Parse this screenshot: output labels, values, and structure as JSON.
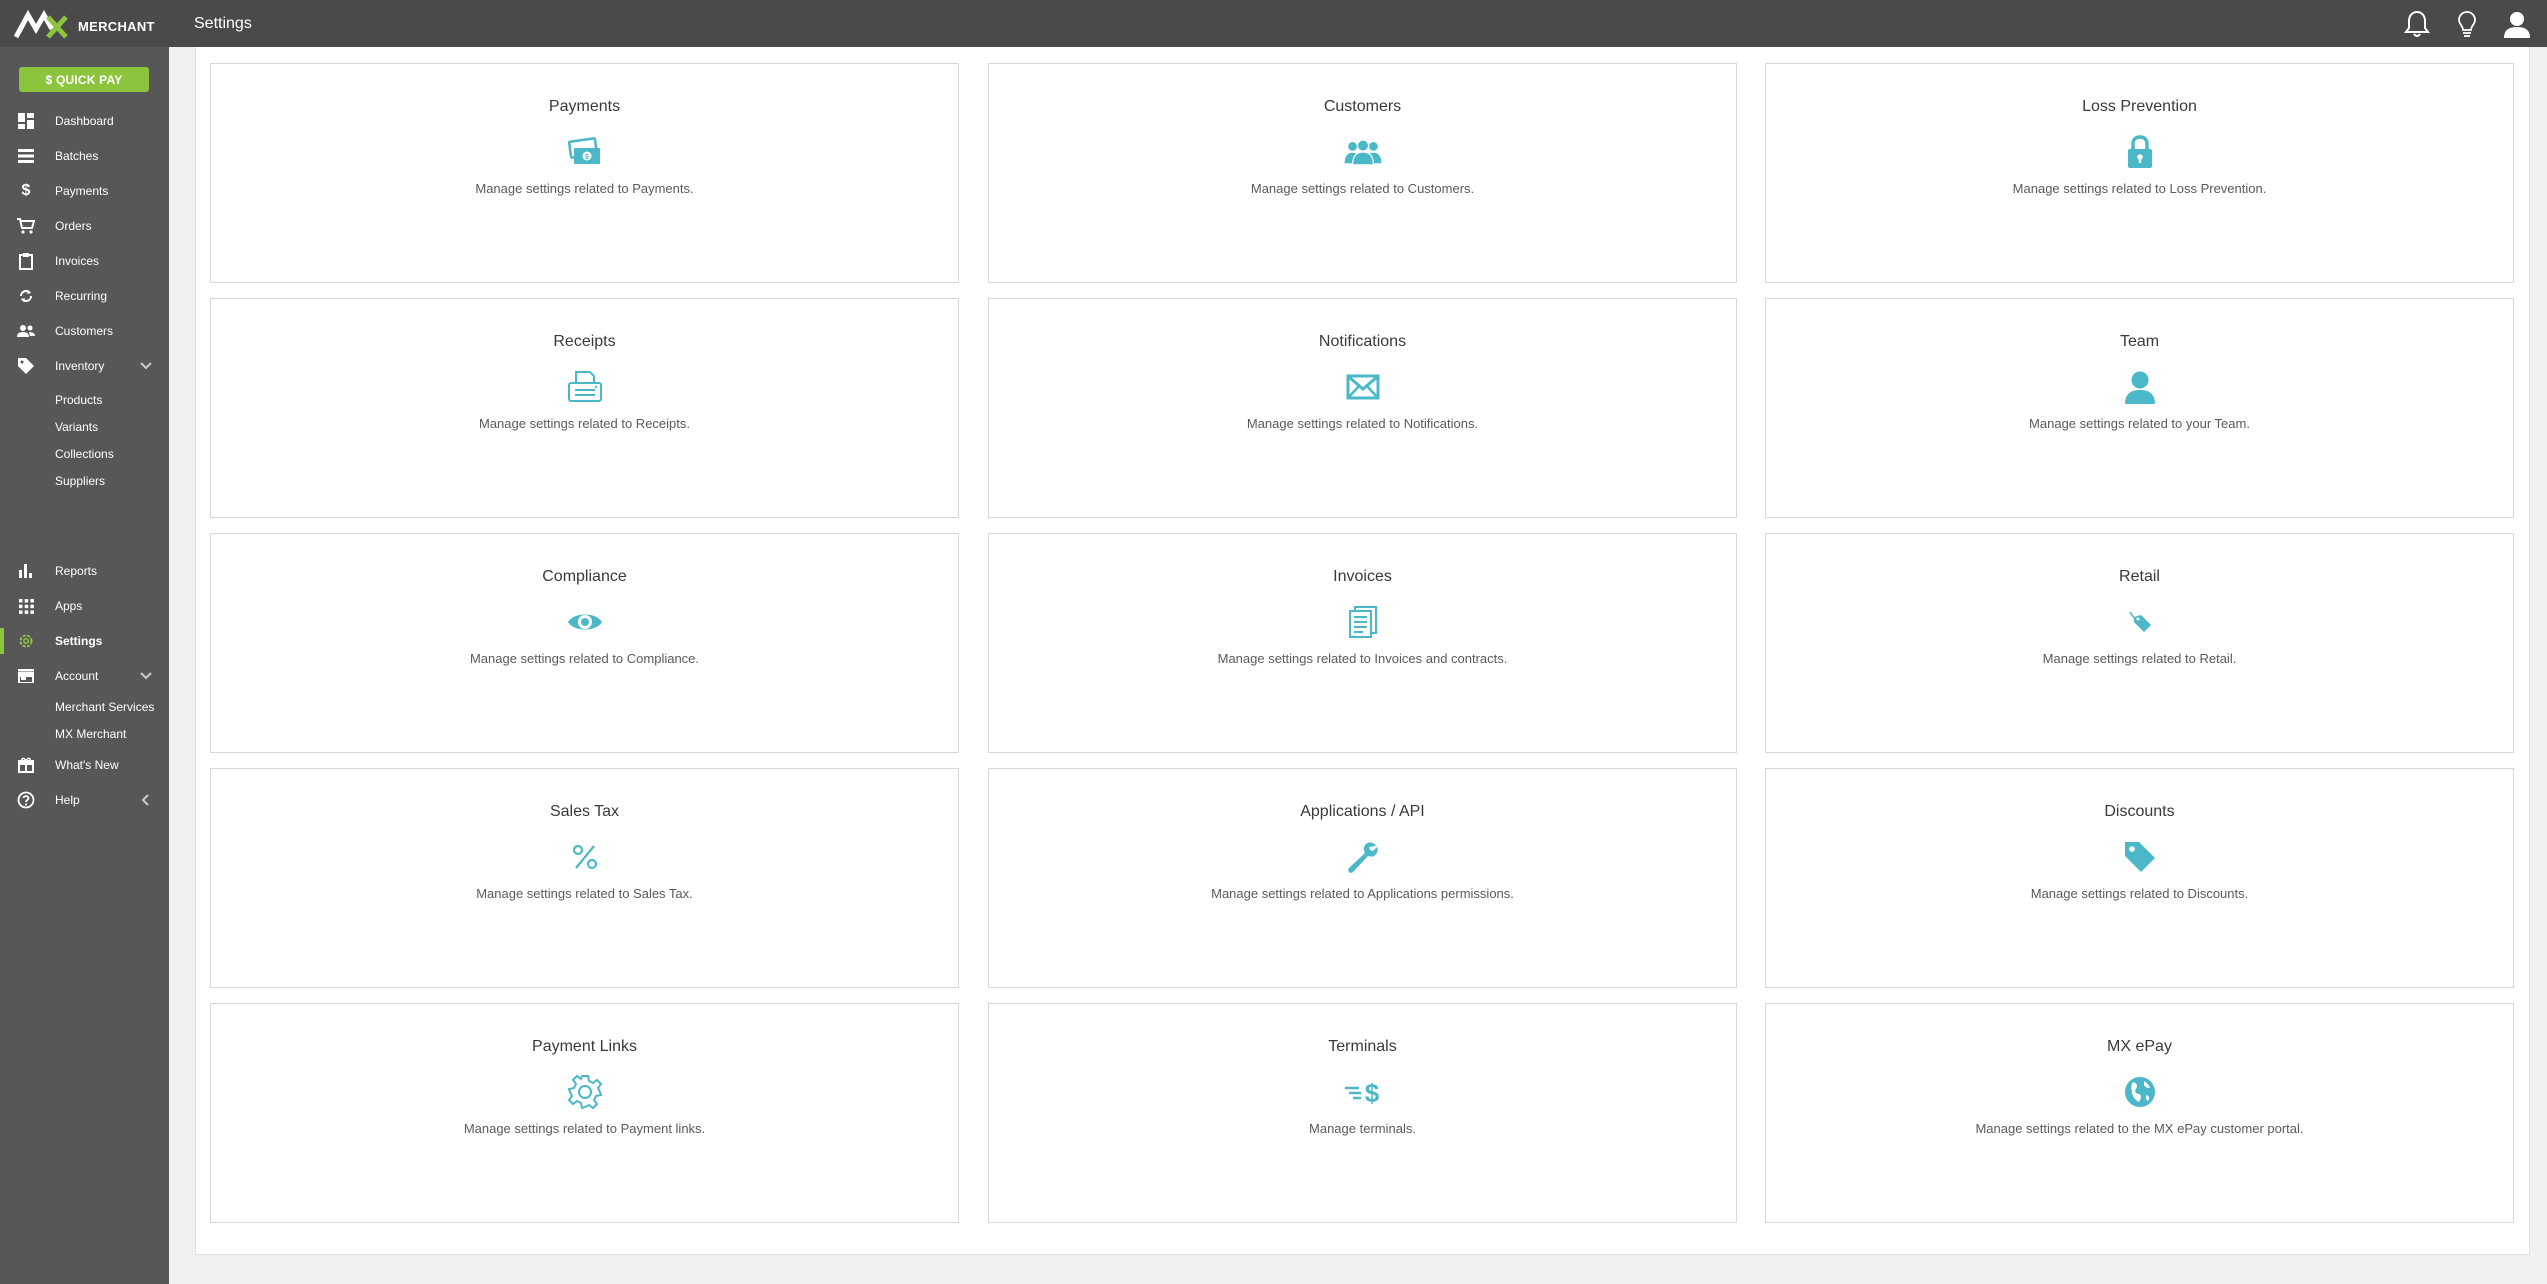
{
  "app": {
    "logo_text": "MERCHANT",
    "page_title": "Settings"
  },
  "colors": {
    "topbar": "#4a4a4a",
    "sidebar": "#575757",
    "accent_green": "#8cc43e",
    "icon_teal": "#4ab8c8"
  },
  "header": {
    "icons": [
      "bell-icon",
      "lightbulb-icon",
      "user-icon"
    ]
  },
  "sidebar": {
    "quick_pay": "$ QUICK PAY",
    "items": {
      "dashboard": "Dashboard",
      "batches": "Batches",
      "payments": "Payments",
      "orders": "Orders",
      "invoices": "Invoices",
      "recurring": "Recurring",
      "customers": "Customers",
      "inventory": "Inventory",
      "reports": "Reports",
      "apps": "Apps",
      "settings": "Settings",
      "account": "Account",
      "whats_new": "What's New",
      "help": "Help"
    },
    "inventory_sub": {
      "products": "Products",
      "variants": "Variants",
      "collections": "Collections",
      "suppliers": "Suppliers"
    },
    "account_sub": {
      "merchant_services": "Merchant Services",
      "mx_merchant": "MX Merchant"
    }
  },
  "cards": [
    {
      "title": "Payments",
      "icon": "money-icon",
      "desc": "Manage settings related to Payments."
    },
    {
      "title": "Customers",
      "icon": "people-icon",
      "desc": "Manage settings related to Customers."
    },
    {
      "title": "Loss Prevention",
      "icon": "lock-icon",
      "desc": "Manage settings related to Loss Prevention."
    },
    {
      "title": "Receipts",
      "icon": "printer-icon",
      "desc": "Manage settings related to Receipts."
    },
    {
      "title": "Notifications",
      "icon": "envelope-icon",
      "desc": "Manage settings related to Notifications."
    },
    {
      "title": "Team",
      "icon": "person-icon",
      "desc": "Manage settings related to your Team."
    },
    {
      "title": "Compliance",
      "icon": "eye-icon",
      "desc": "Manage settings related to Compliance."
    },
    {
      "title": "Invoices",
      "icon": "document-icon",
      "desc": "Manage settings related to Invoices and contracts."
    },
    {
      "title": "Retail",
      "icon": "tag-small-icon",
      "desc": "Manage settings related to Retail."
    },
    {
      "title": "Sales Tax",
      "icon": "percent-icon",
      "desc": "Manage settings related to Sales Tax."
    },
    {
      "title": "Applications / API",
      "icon": "wrench-icon",
      "desc": "Manage settings related to Applications permissions."
    },
    {
      "title": "Discounts",
      "icon": "tag-icon",
      "desc": "Manage settings related to Discounts."
    },
    {
      "title": "Payment Links",
      "icon": "gear-icon",
      "desc": "Manage settings related to Payment links."
    },
    {
      "title": "Terminals",
      "icon": "fast-dollar-icon",
      "desc": "Manage terminals."
    },
    {
      "title": "MX ePay",
      "icon": "globe-icon",
      "desc": "Manage settings related to the MX ePay customer portal."
    }
  ]
}
